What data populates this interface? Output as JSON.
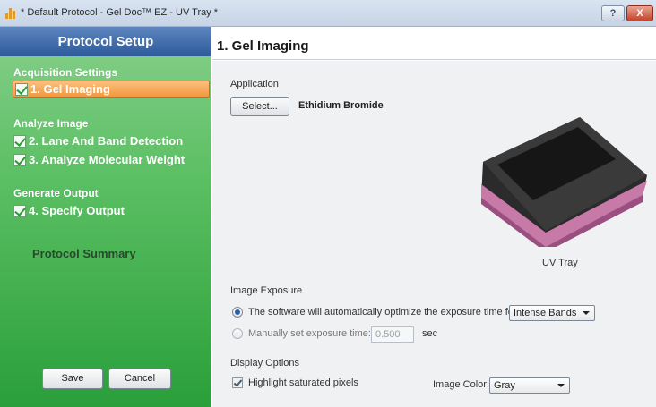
{
  "window": {
    "title": "* Default Protocol - Gel Doc™ EZ - UV Tray *",
    "help_label": "?",
    "close_label": "X"
  },
  "sidebar": {
    "header": "Protocol Setup",
    "sections": [
      {
        "title": "Acquisition Settings",
        "steps": [
          {
            "label": "1. Gel Imaging",
            "checked": true,
            "active": true
          }
        ]
      },
      {
        "title": "Analyze Image",
        "steps": [
          {
            "label": "2. Lane And Band Detection",
            "checked": true
          },
          {
            "label": "3. Analyze Molecular Weight",
            "checked": true
          }
        ]
      },
      {
        "title": "Generate Output",
        "steps": [
          {
            "label": "4. Specify Output",
            "checked": true
          }
        ]
      }
    ],
    "summary_label": "Protocol Summary",
    "save_label": "Save",
    "cancel_label": "Cancel"
  },
  "main": {
    "title": "1. Gel Imaging",
    "application": {
      "label": "Application",
      "select_label": "Select...",
      "value": "Ethidium Bromide",
      "tray_caption": "UV Tray"
    },
    "exposure": {
      "label": "Image Exposure",
      "auto_text": "The software will automatically optimize the exposure time for",
      "auto_option": "Intense Bands",
      "auto_selected": true,
      "manual_text": "Manually set exposure time:",
      "manual_value": "0.500",
      "manual_unit": "sec"
    },
    "display": {
      "label": "Display Options",
      "highlight_label": "Highlight saturated pixels",
      "highlight_checked": true,
      "color_label": "Image Color:",
      "color_value": "Gray"
    }
  },
  "colors": {
    "sidebar_green": "#5bbf63",
    "header_blue": "#2e5a9a",
    "active_orange": "#f3983d",
    "tray_pink": "#c77aa8"
  }
}
